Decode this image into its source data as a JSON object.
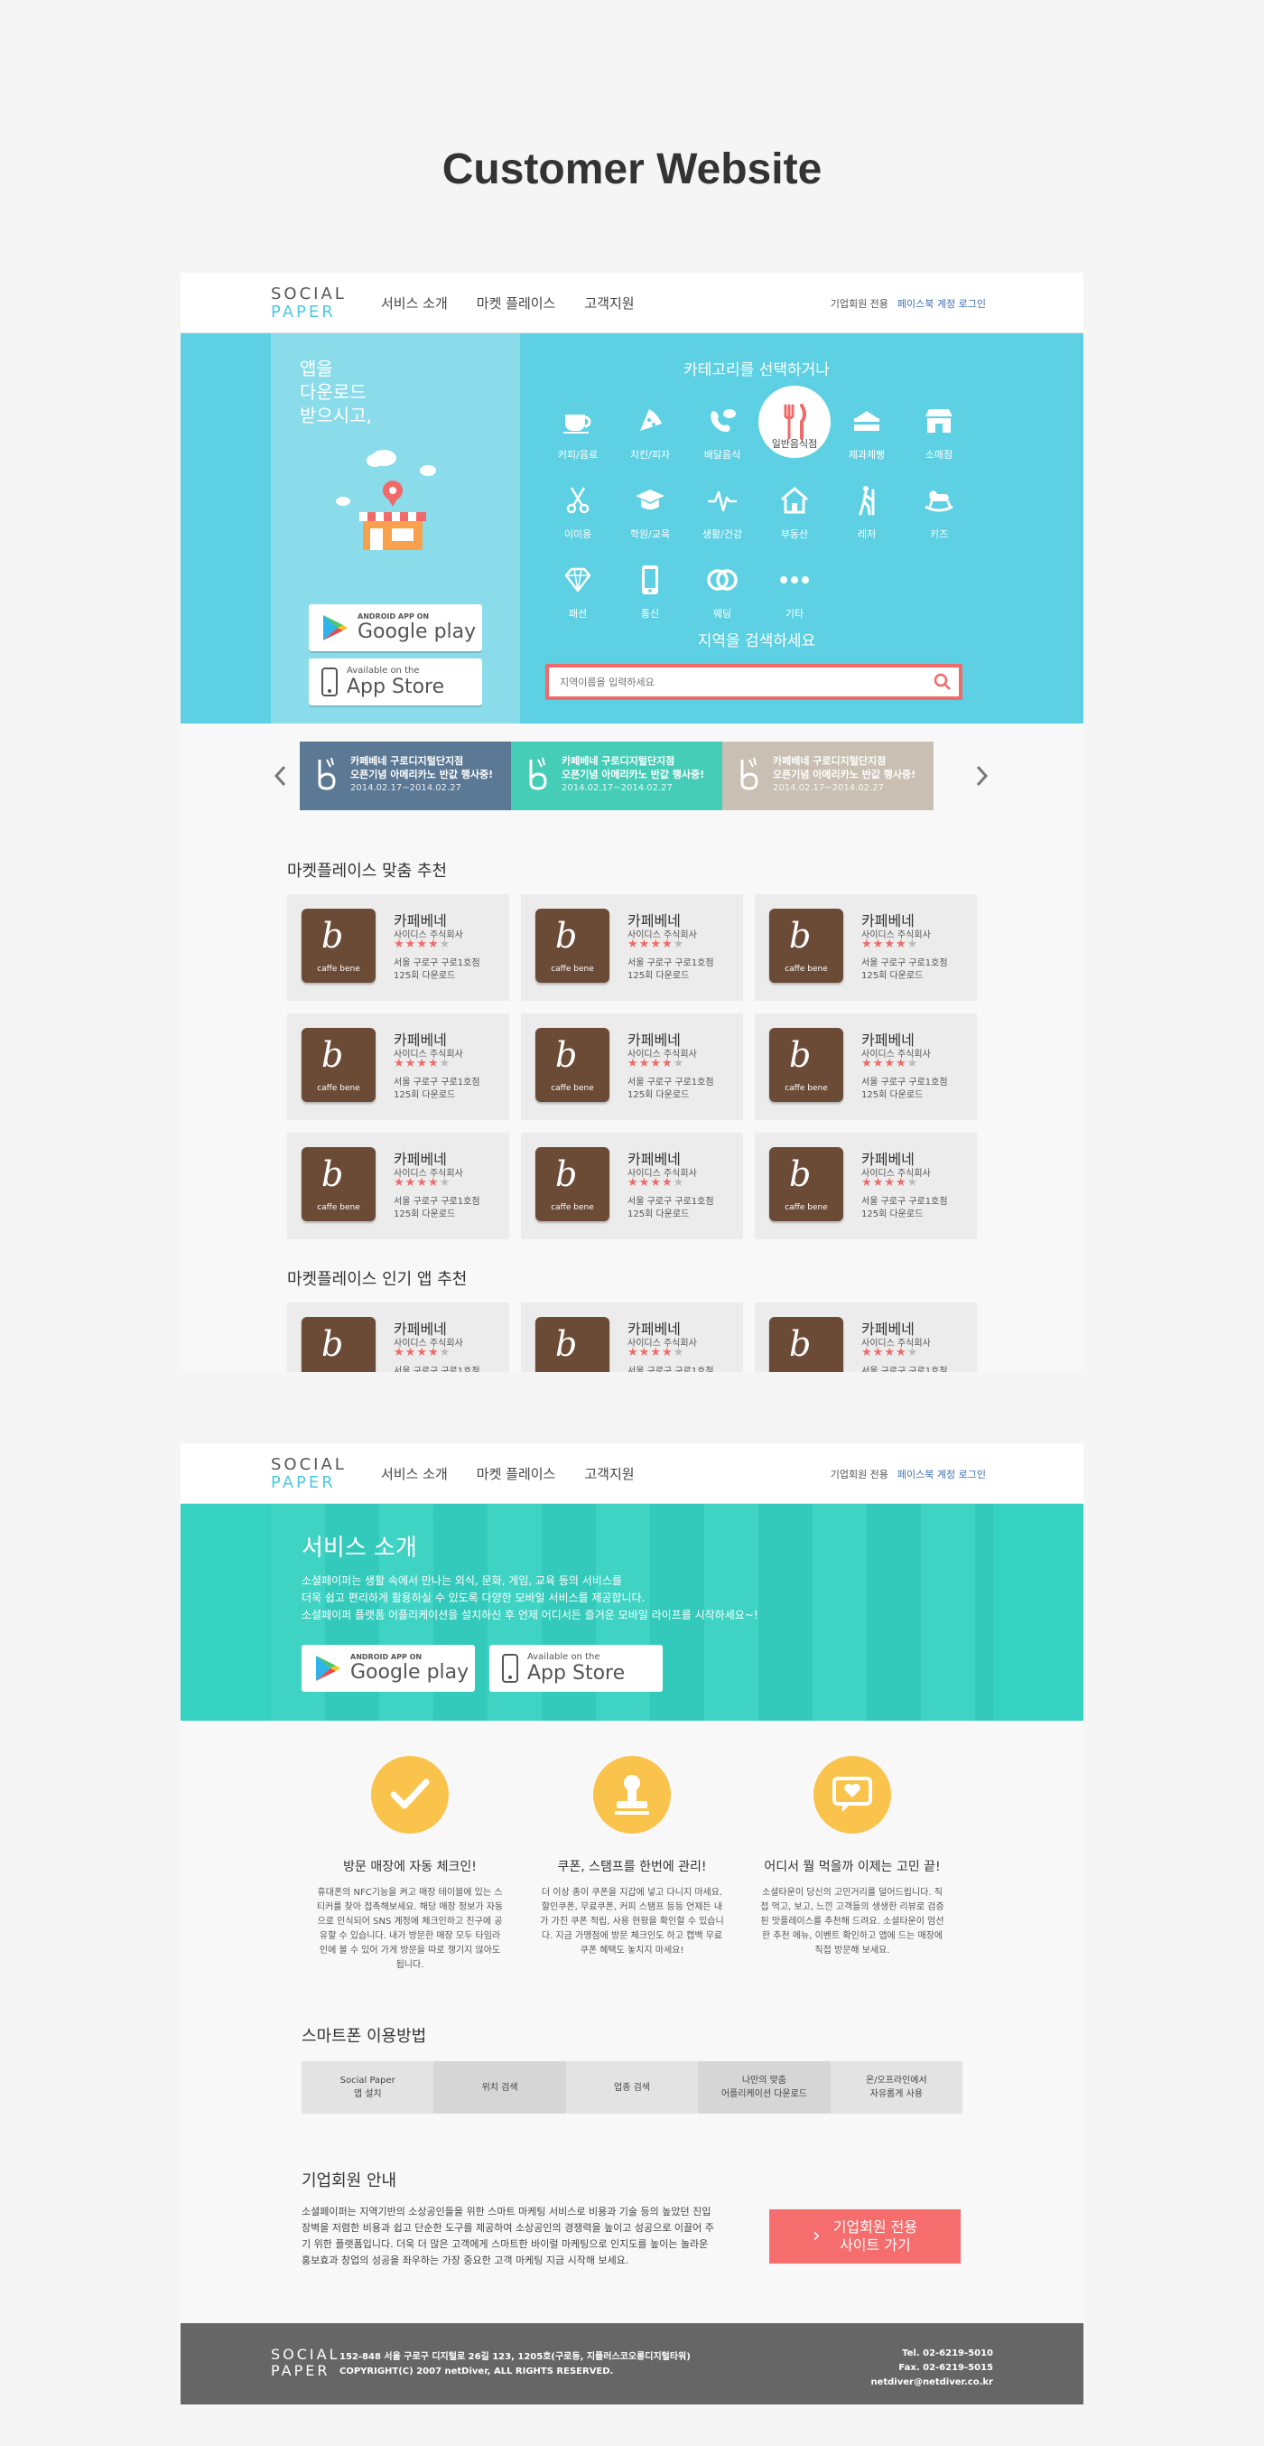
{
  "page_title": "Customer Website",
  "nav": {
    "logo_top": "SOCIAL",
    "logo_bottom": "PAPER",
    "menu": [
      "서비스 소개",
      "마켓 플레이스",
      "고객지원"
    ],
    "corp_link": "기업회원 전용",
    "fb_login": "페이스북 계정 로그인"
  },
  "hero": {
    "tagline": "앱을\n다운로드\n받으시고,",
    "google": {
      "small": "ANDROID APP ON",
      "big": "Google play"
    },
    "appstore": {
      "small": "Available on the",
      "big": "App Store"
    },
    "category_title": "카테고리를 선택하거나",
    "categories": [
      {
        "label": "커피/음료",
        "icon": "coffee-icon"
      },
      {
        "label": "치킨/피자",
        "icon": "pizza-icon"
      },
      {
        "label": "배달음식",
        "icon": "phone-icon"
      },
      {
        "label": "일반음식점",
        "icon": "fork-knife-icon",
        "active": true
      },
      {
        "label": "제과제빵",
        "icon": "cake-icon"
      },
      {
        "label": "소매점",
        "icon": "store-icon"
      },
      {
        "label": "이미용",
        "icon": "scissors-icon"
      },
      {
        "label": "학원/교육",
        "icon": "graduation-cap-icon"
      },
      {
        "label": "생활/건강",
        "icon": "pulse-icon"
      },
      {
        "label": "부동산",
        "icon": "house-icon"
      },
      {
        "label": "레저",
        "icon": "hiker-icon"
      },
      {
        "label": "키즈",
        "icon": "rocking-horse-icon"
      },
      {
        "label": "패션",
        "icon": "diamond-icon"
      },
      {
        "label": "통신",
        "icon": "smartphone-icon"
      },
      {
        "label": "웨딩",
        "icon": "rings-icon"
      },
      {
        "label": "기타",
        "icon": "more-icon"
      }
    ],
    "region_title": "지역을 검색하세요",
    "search_placeholder": "지역이름을 입력하세요"
  },
  "banners": [
    {
      "line1": "카페베네 구로디지털단지점",
      "line2": "오픈기념 아메리카노 반값 행사중!",
      "date": "2014.02.17~2014.02.27",
      "color": "#5b7894"
    },
    {
      "line1": "카페베네 구로디지털단지점",
      "line2": "오픈기념 아메리카노 반값 행사중!",
      "date": "2014.02.17~2014.02.27",
      "color": "#45cdb8"
    },
    {
      "line1": "카페베네 구로디지털단지점",
      "line2": "오픈기념 아메리카노 반값 행사중!",
      "date": "2014.02.17~2014.02.27",
      "color": "#c9bfb2"
    }
  ],
  "section_recommend": "마켓플레이스 맞춤 추천",
  "section_popular": "마켓플레이스 인기 앱 추천",
  "card": {
    "name": "카페베네",
    "company": "사이디스 주식회사",
    "address": "서울 구로구 구로1호점",
    "downloads": "125회 다운로드",
    "thumb_text": "b",
    "thumb_brand": "caffe bene",
    "rating": 4,
    "stars_total": 5
  },
  "service": {
    "title": "서비스 소개",
    "desc1": "소셜페이퍼는 생활 속에서 만나는 외식, 문화, 게임, 교육 등의 서비스를",
    "desc2": "더욱 쉽고 편리하게 활용하실 수 있도록 다양한 모바일 서비스를 제공합니다.",
    "desc3": "소셜페이퍼 플랫폼 어플리케이션을 설치하신 후 언제 어디서든 즐거운 모바일 라이프를 시작하세요~!"
  },
  "features": [
    {
      "title": "방문 매장에 자동 체크인!",
      "icon": "checkmark-icon",
      "desc": "휴대폰의 NFC기능을 켜고 매장 테이블에 있는 스티커를 찾아 접촉해보세요. 해당 매장 정보가 자동으로 인식되어 SNS 계정에 체크인하고 친구에 공유할 수 있습니다. 내가 방문한 매장 모두 타임라인에 볼 수 있어 가게 방문을 따로 챙기지 않아도 됩니다."
    },
    {
      "title": "쿠폰, 스탬프를 한번에 관리!",
      "icon": "stamp-icon",
      "desc": "더 이상 종이 쿠폰을 지갑에 넣고 다니지 마세요. 할인쿠폰, 무료쿠폰, 커피 스탬프 등등 언제든 내가 가진 쿠폰 적립, 사용 현황을 확인할 수 있습니다. 지금 가맹점에 방문 체크인도 하고 캡백 무료 쿠폰 혜택도 놓치지 마세요!"
    },
    {
      "title": "어디서 뭘 먹을까 이제는 고민 끝!",
      "icon": "heart-chat-icon",
      "desc": "소셜타운이 당신의 고민거리를 덜어드립니다. 직접 먹고, 보고, 느낀 고객들의 생생한 리뷰로 검증된 맛플레이스를 추천해 드려요. 소셜타운이 엄선한 추천 메뉴, 이벤트 확인하고 앱에 드는 매장에 직접 방문해 보세요."
    }
  ],
  "howto": {
    "title": "스마트폰 이용방법",
    "steps": [
      "Social Paper\n앱 설치",
      "위치 검색",
      "업종 검색",
      "나만의 맞춤\n어플리케이션 다운로드",
      "온/오프라인에서\n자유롭게 사용"
    ]
  },
  "corp": {
    "title": "기업회원 안내",
    "text": "소셜페이퍼는 지역기반의 소상공인들을 위한 스마트 마케팅 서비스로 비용과 기술 등의 높았던 진입장벽을 저렴한 비용과 쉽고 단순한 도구를 제공하여 소상공인의 경쟁력을 높이고 성공으로 이끌어 주기 위한 플랫폼입니다. 더욱 더 많은 고객에게 스마트한 바이럴 마케팅으로 인지도를 높이는 놀라운 홍보효과 창업의 성공을 좌우하는 가장 중요한 고객 마케팅 지금 시작해 보세요.",
    "button_line1": "기업회원 전용",
    "button_line2": "사이트 가기"
  },
  "footer": {
    "address": "152-848 서울 구로구 디지털로 26길 123, 1205호(구로동, 지플러스코오롱디지털타워)",
    "copyright": "COPYRIGHT(C) 2007 netDiver, ALL RIGHTS RESERVED.",
    "tel": "Tel. 02-6219-5010",
    "fax": "Fax. 02-6219-5015",
    "email": "netdiver@netdiver.co.kr"
  }
}
